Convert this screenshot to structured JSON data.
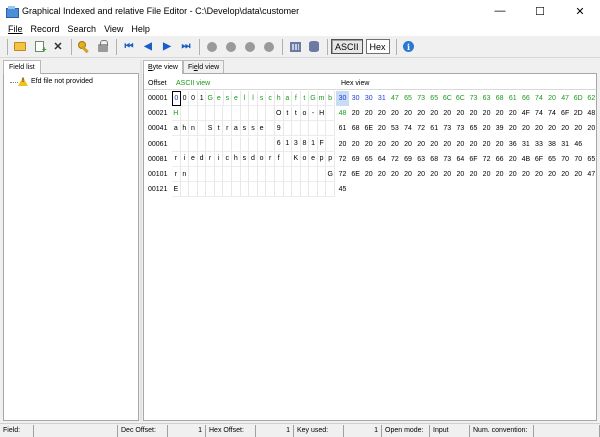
{
  "window": {
    "title": "Graphical Indexed and relative File Editor - C:\\Develop\\data\\customer",
    "minimize": "—",
    "maximize": "☐",
    "close": "✕"
  },
  "menu": [
    {
      "label": "File"
    },
    {
      "label": "Record"
    },
    {
      "label": "Search"
    },
    {
      "label": "View"
    },
    {
      "label": "Help"
    }
  ],
  "toolbar": {
    "ascii_label": "ASCII",
    "hex_label": "Hex",
    "icons": [
      "open-folder-icon",
      "new-record-icon",
      "delete-icon",
      "key-icon",
      "lock-icon",
      "first-icon",
      "previous-icon",
      "next-icon",
      "last-icon",
      "circle-icon",
      "circle-icon",
      "circle-icon",
      "circle-icon",
      "grid-icon",
      "database-icon",
      "info-icon"
    ]
  },
  "left_panel": {
    "tab_label": "Field list",
    "tree_item": "Efd file not provided"
  },
  "right_panel": {
    "tabs": [
      {
        "label_u": "B",
        "label_rest": "yte view"
      },
      {
        "label_pre": "Fi",
        "label_u": "e",
        "label_rest": "ld view"
      }
    ],
    "header": {
      "offset": "Offset",
      "ascii": "ASCII view",
      "hex": "Hex view"
    },
    "rows": [
      {
        "offset": "00001",
        "ascii": [
          "0",
          "0",
          "0",
          "1",
          "G",
          "e",
          "s",
          "e",
          "l",
          "l",
          "s",
          "c",
          "h",
          "a",
          "f",
          "t",
          "G",
          "m",
          "b"
        ],
        "ascii_green": [
          4,
          5,
          6,
          7,
          8,
          9,
          10,
          11,
          12,
          13,
          14,
          15,
          16,
          17,
          18
        ],
        "hex": [
          "30",
          "30",
          "30",
          "31",
          "47",
          "65",
          "73",
          "65",
          "6C",
          "6C",
          "73",
          "63",
          "68",
          "61",
          "66",
          "74",
          "20",
          "47",
          "6D",
          "62"
        ],
        "hex_blue": [
          0,
          1,
          2,
          3
        ]
      },
      {
        "offset": "00021",
        "ascii": [
          "H",
          "",
          "",
          "",
          "",
          "",
          "",
          "",
          "",
          "",
          "",
          "",
          "O",
          "t",
          "t",
          "o",
          "-",
          "H",
          ""
        ],
        "ascii_green": [
          0
        ],
        "hex": [
          "48",
          "20",
          "20",
          "20",
          "20",
          "20",
          "20",
          "20",
          "20",
          "20",
          "20",
          "20",
          "20",
          "20",
          "4F",
          "74",
          "74",
          "6F",
          "2D",
          "48"
        ],
        "hex_green": [
          0
        ]
      },
      {
        "offset": "00041",
        "ascii": [
          "a",
          "h",
          "n",
          "",
          "S",
          "t",
          "r",
          "a",
          "s",
          "s",
          "e",
          "",
          "9",
          "",
          "",
          "",
          "",
          "",
          ""
        ],
        "hex": [
          "61",
          "68",
          "6E",
          "20",
          "53",
          "74",
          "72",
          "61",
          "73",
          "73",
          "65",
          "20",
          "39",
          "20",
          "20",
          "20",
          "20",
          "20",
          "20",
          "20"
        ]
      },
      {
        "offset": "00061",
        "ascii": [
          "",
          "",
          "",
          "",
          "",
          "",
          "",
          "",
          "",
          "",
          "",
          "",
          "6",
          "1",
          "3",
          "8",
          "1",
          "F",
          ""
        ],
        "hex": [
          "20",
          "20",
          "20",
          "20",
          "20",
          "20",
          "20",
          "20",
          "20",
          "20",
          "20",
          "20",
          "20",
          "36",
          "31",
          "33",
          "38",
          "31",
          "46",
          ""
        ]
      },
      {
        "offset": "00081",
        "ascii": [
          "r",
          "i",
          "e",
          "d",
          "r",
          "i",
          "c",
          "h",
          "s",
          "d",
          "o",
          "r",
          "f",
          "",
          "K",
          "o",
          "e",
          "p",
          "p"
        ],
        "hex": [
          "72",
          "69",
          "65",
          "64",
          "72",
          "69",
          "63",
          "68",
          "73",
          "64",
          "6F",
          "72",
          "66",
          "20",
          "4B",
          "6F",
          "65",
          "70",
          "70",
          "65"
        ]
      },
      {
        "offset": "00101",
        "ascii": [
          "r",
          "n",
          "",
          "",
          "",
          "",
          "",
          "",
          "",
          "",
          "",
          "",
          "",
          "",
          "",
          "",
          "",
          "",
          "G"
        ],
        "hex": [
          "72",
          "6E",
          "20",
          "20",
          "20",
          "20",
          "20",
          "20",
          "20",
          "20",
          "20",
          "20",
          "20",
          "20",
          "20",
          "20",
          "20",
          "20",
          "20",
          "47"
        ]
      },
      {
        "offset": "00121",
        "ascii": [
          "E",
          "",
          "",
          "",
          "",
          "",
          "",
          "",
          "",
          "",
          "",
          "",
          "",
          "",
          "",
          "",
          "",
          "",
          ""
        ],
        "hex": [
          "45",
          "",
          "",
          "",
          "",
          "",
          "",
          "",
          "",
          "",
          "",
          "",
          "",
          "",
          "",
          "",
          "",
          "",
          "",
          ""
        ]
      }
    ]
  },
  "statusbar": {
    "field_label": "Field:",
    "field_value": "",
    "dec_offset_label": "Dec Offset:",
    "dec_offset_value": "1",
    "hex_offset_label": "Hex Offset:",
    "hex_offset_value": "1",
    "key_used_label": "Key used:",
    "key_used_value": "1",
    "open_mode_label": "Open mode:",
    "open_mode_value": "Input",
    "num_convention_label": "Num. convention:",
    "num_convention_value": ""
  }
}
